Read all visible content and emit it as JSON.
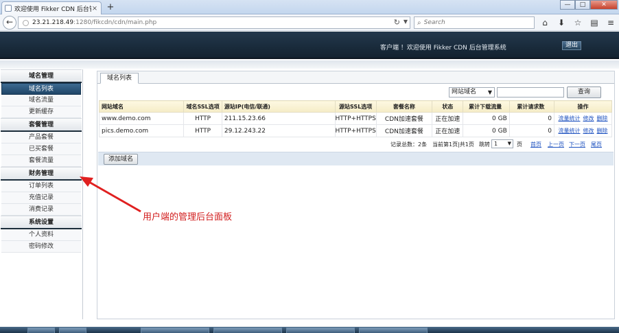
{
  "browser": {
    "tab_title": "欢迎使用 Fikker CDN 后台管...",
    "tab_close": "×",
    "new_tab": "+",
    "url_host": "23.21.218.49",
    "url_path": ":1280/fikcdn/cdn/main.php",
    "search_placeholder": "Search",
    "window_min": "—",
    "window_max": "□",
    "window_close": "✕"
  },
  "header": {
    "welcome": "客户端 ！欢迎使用 Fikker CDN 后台管理系统",
    "logout": "退出"
  },
  "sidebar": {
    "groups": [
      {
        "title": "域名管理",
        "items": [
          "域名列表",
          "域名流量",
          "更新缓存"
        ]
      },
      {
        "title": "套餐管理",
        "items": [
          "产品套餐",
          "已买套餐",
          "套餐流量"
        ]
      },
      {
        "title": "财务管理",
        "items": [
          "订单列表",
          "充值记录",
          "消费记录"
        ]
      },
      {
        "title": "系统设置",
        "items": [
          "个人资料",
          "密码修改"
        ]
      }
    ],
    "active_item": "域名列表"
  },
  "main": {
    "tab": "域名列表",
    "search_type": "网站域名",
    "search_value": "",
    "search_button": "查询",
    "columns": [
      "网站域名",
      "域名SSL选项",
      "源站IP(电信/联通)",
      "源站SSL选项",
      "套餐名称",
      "状态",
      "累计下载流量",
      "累计请求数",
      "操作"
    ],
    "rows": [
      {
        "domain": "www.demo.com",
        "ssl": "HTTP",
        "ip": "211.15.23.66",
        "src_ssl": "HTTP+HTTPS",
        "package": "CDN加速套餐",
        "status": "正在加速",
        "traffic": "0 GB",
        "requests": "0"
      },
      {
        "domain": "pics.demo.com",
        "ssl": "HTTP",
        "ip": "29.12.243.22",
        "src_ssl": "HTTP+HTTPS",
        "package": "CDN加速套餐",
        "status": "正在加速",
        "traffic": "0 GB",
        "requests": "0"
      }
    ],
    "row_actions": [
      "流量统计",
      "修改",
      "删除"
    ],
    "pager": {
      "total": "记录总数：2条",
      "current": "当前第1页|共1页",
      "jump_label": "跳转",
      "jump_value": "1",
      "page_unit": "页",
      "first": "首页",
      "prev": "上一页",
      "next": "下一页",
      "last": "尾页"
    },
    "add_button": "添加域名"
  },
  "annotation": {
    "text": "用户端的管理后台面板",
    "color": "#d11b1b"
  }
}
